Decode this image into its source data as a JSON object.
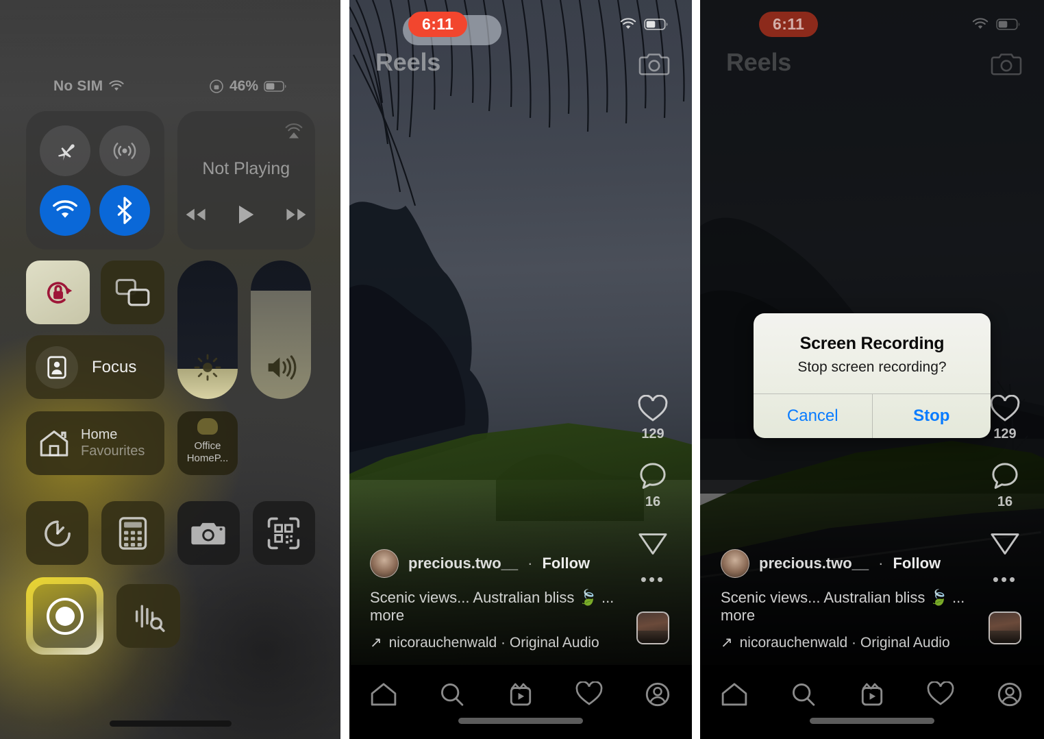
{
  "control_center": {
    "status_bar": {
      "carrier": "No SIM",
      "wifi_icon": "wifi-icon",
      "rotation_lock_icon": "rotation-lock-status-icon",
      "battery_percent": "46%",
      "battery_icon": "battery-icon"
    },
    "connectivity": {
      "airplane_icon": "airplane-mode-icon",
      "cellular_icon": "cellular-data-icon",
      "wifi_icon": "wifi-toggle-icon",
      "bluetooth_icon": "bluetooth-toggle-icon"
    },
    "media": {
      "title": "Not Playing",
      "airplay_icon": "airplay-icon",
      "rewind_icon": "rewind-icon",
      "play_icon": "play-icon",
      "forward_icon": "fast-forward-icon"
    },
    "rotation_lock_label": "rotation-lock-icon",
    "screen_mirroring_label": "screen-mirroring-icon",
    "focus": {
      "label": "Focus",
      "icon": "focus-icon"
    },
    "brightness": {
      "icon": "brightness-icon",
      "level_percent": 22
    },
    "volume": {
      "icon": "volume-icon",
      "level_percent": 78
    },
    "home": {
      "line1": "Home",
      "line2": "Favourites",
      "icon": "home-icon"
    },
    "homepod": {
      "line1": "Office",
      "line2": "HomeP...",
      "icon": "homepod-icon"
    },
    "apps": [
      {
        "name": "timer-icon"
      },
      {
        "name": "calculator-icon"
      },
      {
        "name": "camera-icon"
      },
      {
        "name": "qr-code-scanner-icon"
      }
    ],
    "screen_record": {
      "icon": "screen-record-icon",
      "state": "highlighted"
    },
    "sound_recognition": {
      "icon": "sound-recognition-icon"
    },
    "accent_highlight": "#e8d531"
  },
  "reel_screen": {
    "status": {
      "time": "6:11",
      "recording_pill_color": "#f2462e",
      "wifi_icon": "wifi-icon",
      "battery_icon": "battery-icon"
    },
    "title": "Reels",
    "camera_icon": "camera-icon",
    "rail": {
      "like_icon": "heart-icon",
      "like_count": "129",
      "comment_icon": "comment-icon",
      "comment_count": "16",
      "share_icon": "share-icon",
      "more_icon": "more-options-icon",
      "thumbnail": "audio-thumbnail"
    },
    "caption": {
      "avatar": "user-avatar",
      "username": "precious.two__",
      "separator": "·",
      "follow_label": "Follow",
      "text": "Scenic views... Australian bliss 🍃 ... more",
      "audio_arrow": "↗",
      "audio": "nicorauchenwald · Original Audio"
    },
    "tabs": [
      {
        "name": "tab-home",
        "icon": "home-icon"
      },
      {
        "name": "tab-search",
        "icon": "search-icon"
      },
      {
        "name": "tab-reels",
        "icon": "reels-icon"
      },
      {
        "name": "tab-activity",
        "icon": "heart-icon"
      },
      {
        "name": "tab-profile",
        "icon": "profile-icon"
      }
    ]
  },
  "alert": {
    "title": "Screen Recording",
    "message": "Stop screen recording?",
    "cancel_label": "Cancel",
    "stop_label": "Stop",
    "accent": "#0a7cff"
  }
}
